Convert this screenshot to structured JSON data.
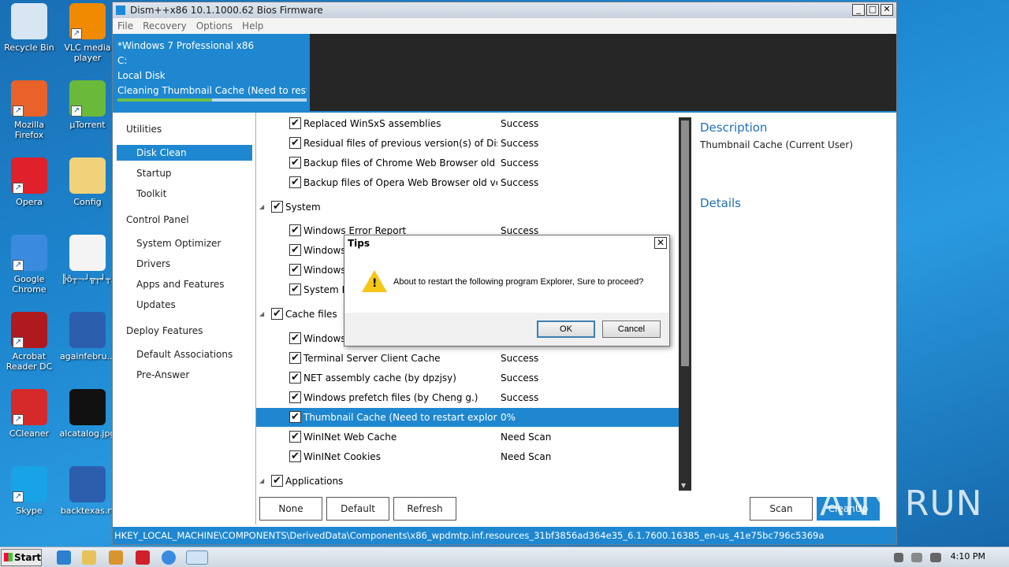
{
  "desktop_icons": [
    {
      "label": "Recycle Bin",
      "icon": "recycle-bin-icon",
      "color": "#d8e6f3"
    },
    {
      "label": "VLC media player",
      "icon": "vlc-icon",
      "color": "#f08a00"
    },
    {
      "label": "Mozilla Firefox",
      "icon": "firefox-icon",
      "color": "#e8622a"
    },
    {
      "label": "µTorrent",
      "icon": "utorrent-icon",
      "color": "#6bb93a"
    },
    {
      "label": "Opera",
      "icon": "opera-icon",
      "color": "#e0202a"
    },
    {
      "label": "Config",
      "icon": "folder-icon",
      "color": "#f0d27a"
    },
    {
      "label": "Google Chrome",
      "icon": "chrome-icon",
      "color": "#3a8be0"
    },
    {
      "label": "╠ô┬¬┘╦┬╛┬.",
      "icon": "file-icon",
      "color": "#f4f4f4"
    },
    {
      "label": "Acrobat Reader DC",
      "icon": "acrobat-icon",
      "color": "#b0191e"
    },
    {
      "label": "againfebru...",
      "icon": "word-doc-icon",
      "color": "#2b5fae"
    },
    {
      "label": "CCleaner",
      "icon": "ccleaner-icon",
      "color": "#d62a2a"
    },
    {
      "label": "alcatalog.jpg",
      "icon": "image-file-icon",
      "color": "#111111"
    },
    {
      "label": "Skype",
      "icon": "skype-icon",
      "color": "#17a3e6"
    },
    {
      "label": "backtexas.rt",
      "icon": "word-doc-icon",
      "color": "#2b5fae"
    }
  ],
  "window": {
    "title": "Dism++x86 10.1.1000.62 Bios Firmware",
    "menu": [
      "File",
      "Recovery",
      "Options",
      "Help"
    ],
    "system": {
      "os": "*Windows 7 Professional x86",
      "drive": "C:",
      "disk": "Local Disk",
      "task": "Cleaning Thumbnail Cache (Need to restart explorer)",
      "progress": 0.5
    }
  },
  "nav": {
    "utilities": "Utilities",
    "disk_clean": "Disk Clean",
    "startup": "Startup",
    "toolkit": "Toolkit",
    "control_panel": "Control Panel",
    "system_optimizer": "System Optimizer",
    "drivers": "Drivers",
    "apps_features": "Apps and Features",
    "updates": "Updates",
    "deploy_features": "Deploy Features",
    "default_associations": "Default Associations",
    "pre_answer": "Pre-Answer"
  },
  "list": {
    "rows": [
      {
        "name": "Replaced WinSxS assemblies",
        "status": "Success"
      },
      {
        "name": "Residual files of previous version(s) of Dism++",
        "status": "Success"
      },
      {
        "name": "Backup files of Chrome Web Browser old version",
        "status": "Success"
      },
      {
        "name": "Backup files of Opera Web Browser old version",
        "status": "Success"
      },
      {
        "group": "System"
      },
      {
        "name": "Windows Error Report",
        "status": "Success"
      },
      {
        "name": "Windows",
        "status": ""
      },
      {
        "name": "Windows",
        "status": ""
      },
      {
        "name": "System Re",
        "status": ""
      },
      {
        "group": "Cache files"
      },
      {
        "name": "Windows",
        "status": ""
      },
      {
        "name": "Terminal Server Client Cache",
        "status": "Success"
      },
      {
        "name": "NET assembly cache (by dpzjsy)",
        "status": "Success"
      },
      {
        "name": "Windows prefetch files (by Cheng g.)",
        "status": "Success"
      },
      {
        "name": "Thumbnail Cache (Need to restart explorer)",
        "status": "0%",
        "selected": true
      },
      {
        "name": "WinINet Web Cache",
        "status": "Need Scan"
      },
      {
        "name": "WinINet Cookies",
        "status": "Need Scan"
      },
      {
        "group": "Applications"
      }
    ]
  },
  "panel": {
    "description_h": "Description",
    "description": "Thumbnail Cache (Current User)",
    "details_h": "Details"
  },
  "buttons": {
    "none": "None",
    "default": "Default",
    "refresh": "Refresh",
    "scan": "Scan",
    "cleanup": "CleanUp"
  },
  "status_path": "HKEY_LOCAL_MACHINE\\COMPONENTS\\DerivedData\\Components\\x86_wpdmtp.inf.resources_31bf3856ad364e35_6.1.7600.16385_en-us_41e75bc796c5369a",
  "dialog": {
    "title": "Tips",
    "message": "About to restart the following program Explorer, Sure to proceed?",
    "ok": "OK",
    "cancel": "Cancel"
  },
  "taskbar": {
    "start": "Start",
    "clock": "4:10 PM"
  },
  "watermark": "ANY RUN"
}
